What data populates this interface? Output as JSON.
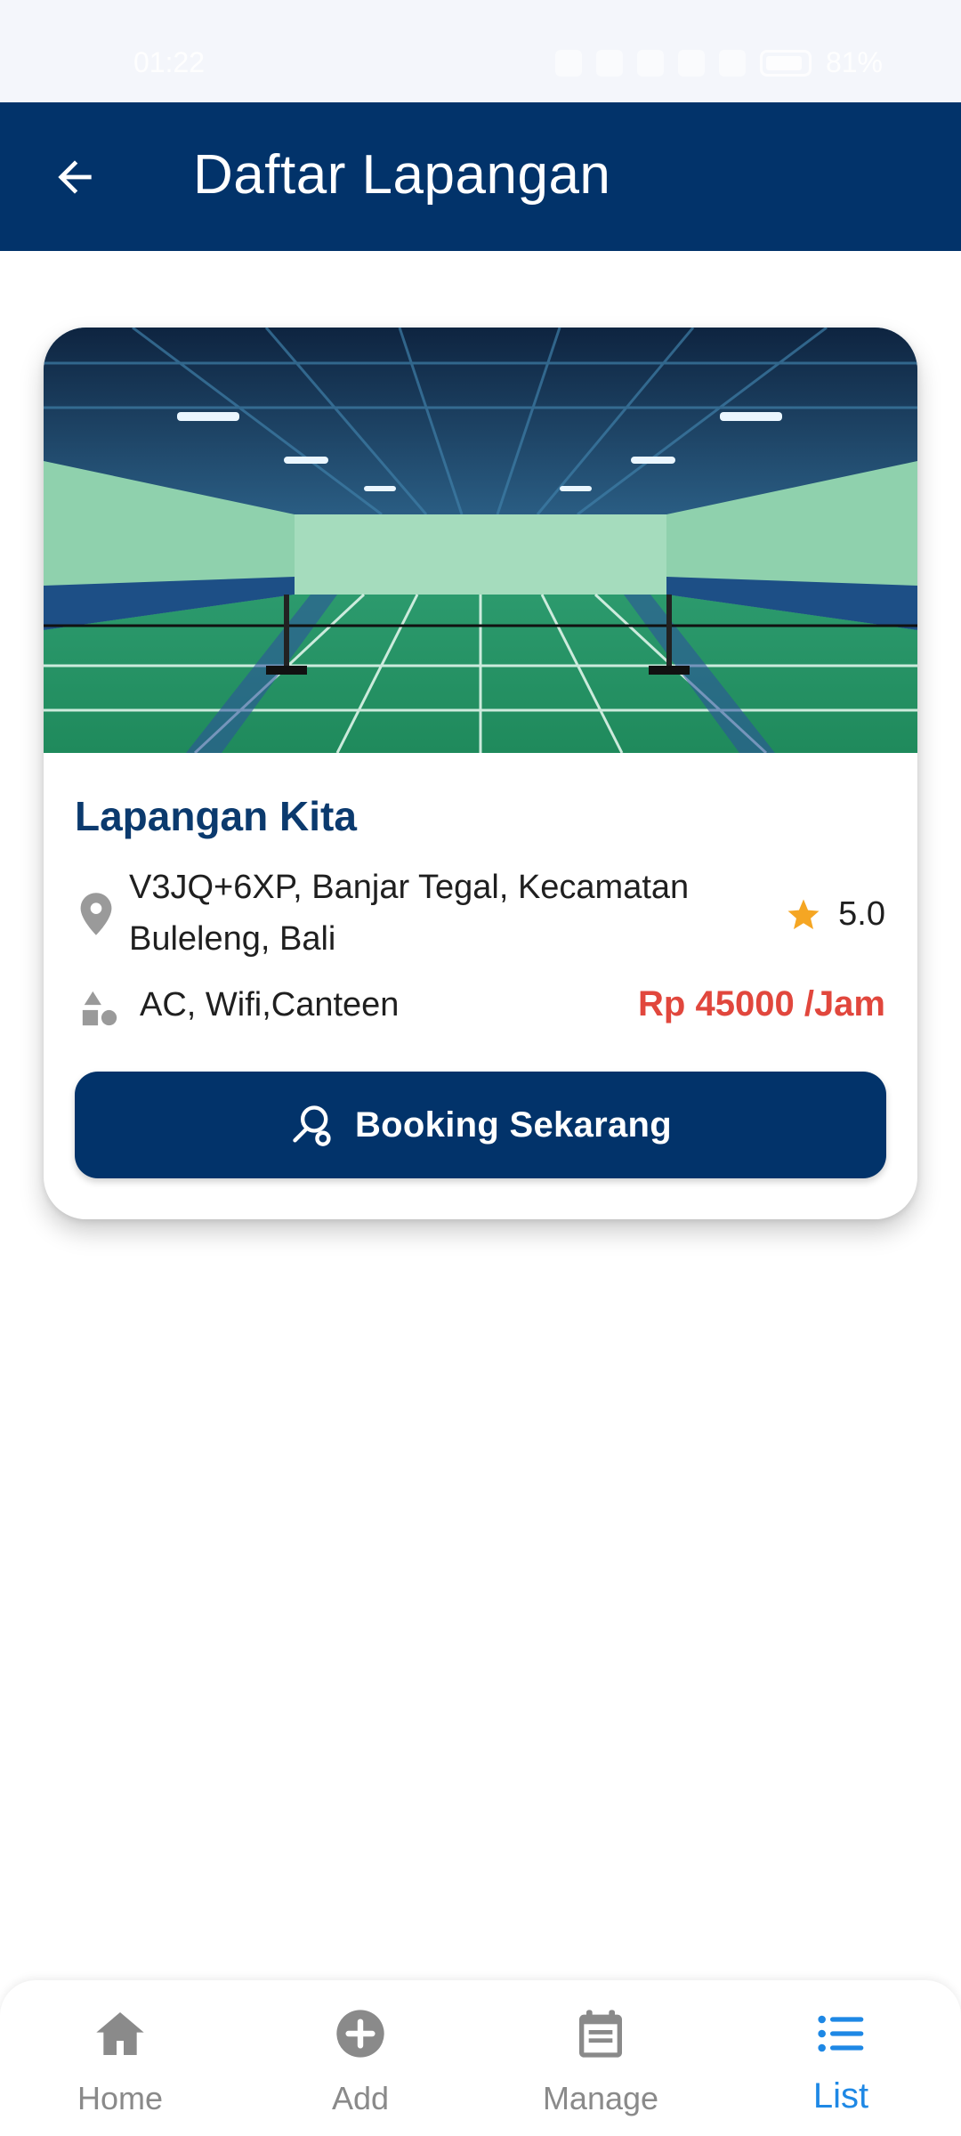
{
  "status_bar": {
    "time": "01:22",
    "battery": "81%"
  },
  "app_bar": {
    "title": "Daftar Lapangan",
    "back_icon": "arrow-left-icon"
  },
  "venue": {
    "name": "Lapangan Kita",
    "address": "V3JQ+6XP, Banjar Tegal, Kecamatan Buleleng, Bali",
    "rating": "5.0",
    "facilities": "AC, Wifi,Canteen",
    "price": "Rp 45000 /Jam",
    "book_label": "Booking Sekarang"
  },
  "bottom_nav": {
    "items": [
      {
        "label": "Home",
        "icon": "home-icon"
      },
      {
        "label": "Add",
        "icon": "add-circle-icon"
      },
      {
        "label": "Manage",
        "icon": "calendar-note-icon"
      },
      {
        "label": "List",
        "icon": "list-icon",
        "active": true
      }
    ]
  },
  "colors": {
    "primary": "#02336a",
    "price": "#e1473d",
    "star": "#f5a623",
    "active_nav": "#1e88e5",
    "muted": "#8a8a8a"
  }
}
